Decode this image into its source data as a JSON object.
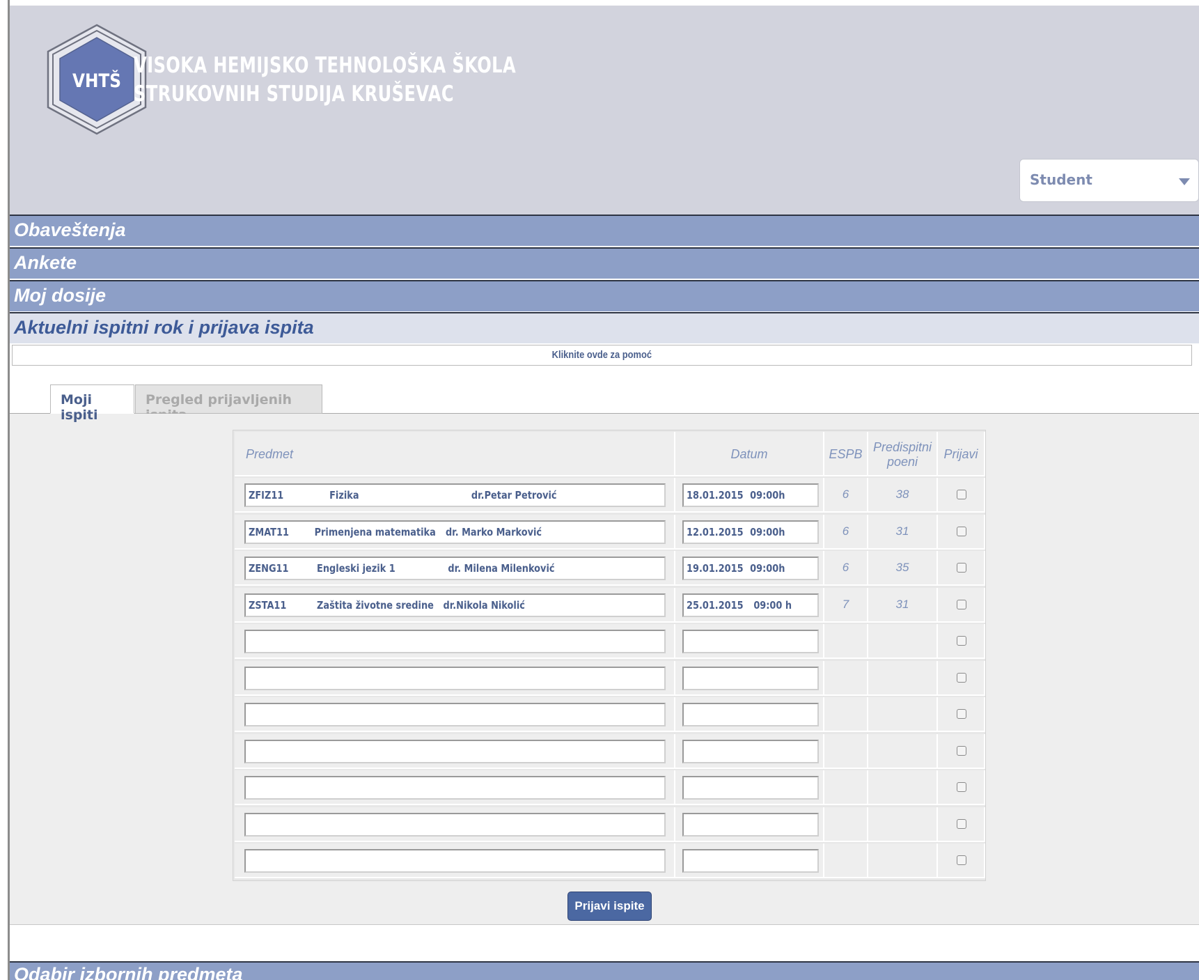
{
  "header": {
    "logo_text": "VHTŠ",
    "school_name_line1": "VISOKA HEMIJSKO TEHNOLOŠKA ŠKOLA",
    "school_name_line2": "STRUKOVNIH STUDIJA KRUŠEVAC",
    "role_select": {
      "value": "Student"
    }
  },
  "sections": [
    {
      "label": "Obaveštenja"
    },
    {
      "label": "Ankete"
    },
    {
      "label": "Moj dosije"
    },
    {
      "label": "Aktuelni ispitni rok i prijava ispita"
    }
  ],
  "help_link": "Kliknite ovde za pomoć",
  "tabs": [
    {
      "label": "Moji ispiti"
    },
    {
      "label": "Pregled prijavljenih ispita"
    }
  ],
  "exam_table": {
    "headers": {
      "predmet": "Predmet",
      "datum": "Datum",
      "espb": "ESPB",
      "predispitni_line1": "Predispitni",
      "predispitni_line2": "poeni",
      "prijavi": "Prijavi"
    },
    "rows": [
      {
        "code": "ZFIZ11",
        "subject": "Fizika",
        "professor": "dr.Petar Petrović",
        "date": "18.01.2015",
        "time": "09:00h",
        "espb": "6",
        "points": "38"
      },
      {
        "code": "ZMAT11",
        "subject": "Primenjena matematika",
        "professor": "dr. Marko Marković",
        "date": "12.01.2015",
        "time": "09:00h",
        "espb": "6",
        "points": "31"
      },
      {
        "code": "ZENG11",
        "subject": "Engleski jezik 1",
        "professor": "dr. Milena Milenković",
        "date": "19.01.2015",
        "time": "09:00h",
        "espb": "6",
        "points": "35"
      },
      {
        "code": "ZSTA11",
        "subject": "Zaštita životne sredine",
        "professor": "dr.Nikola Nikolić",
        "date": "25.01.2015",
        "time": "09:00 h",
        "espb": "7",
        "points": "31"
      }
    ],
    "empty_rows": 7
  },
  "submit_button": "Prijavi ispite",
  "bottom_section": {
    "label": "Odabir izbornih predmeta"
  },
  "colors": {
    "header_bg": "#d2d3dd",
    "section_bar": "#8d9fc7",
    "active_section": "#dde1ec",
    "accent": "#4b68a2",
    "text_blue": "#4a5f8c"
  },
  "icons": {
    "logo": "hexagon-logo-icon",
    "dropdown": "chevron-down-icon"
  }
}
